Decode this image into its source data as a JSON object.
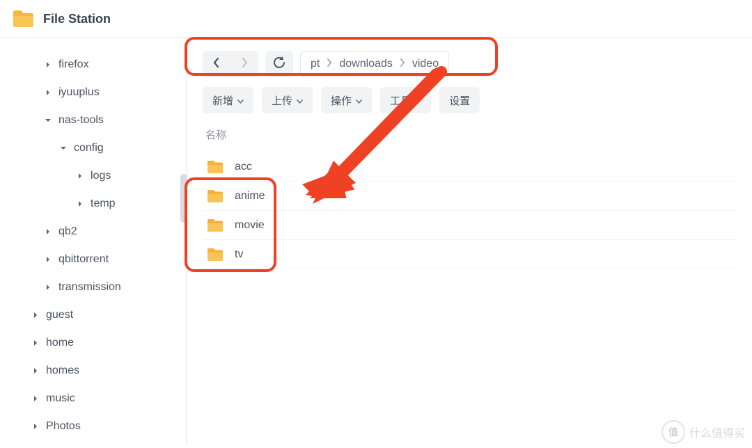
{
  "app": {
    "title": "File Station"
  },
  "sidebar": {
    "items": [
      {
        "label": "firefox",
        "expanded": false,
        "level": 0
      },
      {
        "label": "iyuuplus",
        "expanded": false,
        "level": 0
      },
      {
        "label": "nas-tools",
        "expanded": true,
        "level": 0
      },
      {
        "label": "config",
        "expanded": true,
        "level": 1
      },
      {
        "label": "logs",
        "expanded": false,
        "level": 2
      },
      {
        "label": "temp",
        "expanded": false,
        "level": 2
      },
      {
        "label": "qb2",
        "expanded": false,
        "level": 0
      },
      {
        "label": "qbittorrent",
        "expanded": false,
        "level": 0
      },
      {
        "label": "transmission",
        "expanded": false,
        "level": 0
      },
      {
        "label": "guest",
        "expanded": false,
        "level": -1
      },
      {
        "label": "home",
        "expanded": false,
        "level": -1
      },
      {
        "label": "homes",
        "expanded": false,
        "level": -1
      },
      {
        "label": "music",
        "expanded": false,
        "level": -1
      },
      {
        "label": "Photos",
        "expanded": false,
        "level": -1
      }
    ]
  },
  "breadcrumb": {
    "parts": [
      "pt",
      "downloads",
      "video"
    ]
  },
  "toolbar": {
    "buttons": [
      {
        "label": "新增",
        "hasCaret": true
      },
      {
        "label": "上传",
        "hasCaret": true
      },
      {
        "label": "操作",
        "hasCaret": true
      },
      {
        "label": "工具",
        "hasCaret": true
      },
      {
        "label": "设置",
        "hasCaret": false
      }
    ]
  },
  "columnHeader": "名称",
  "files": [
    {
      "name": "acc"
    },
    {
      "name": "anime"
    },
    {
      "name": "movie"
    },
    {
      "name": "tv"
    }
  ],
  "watermark": {
    "badge": "值",
    "text": "什么值得买"
  }
}
